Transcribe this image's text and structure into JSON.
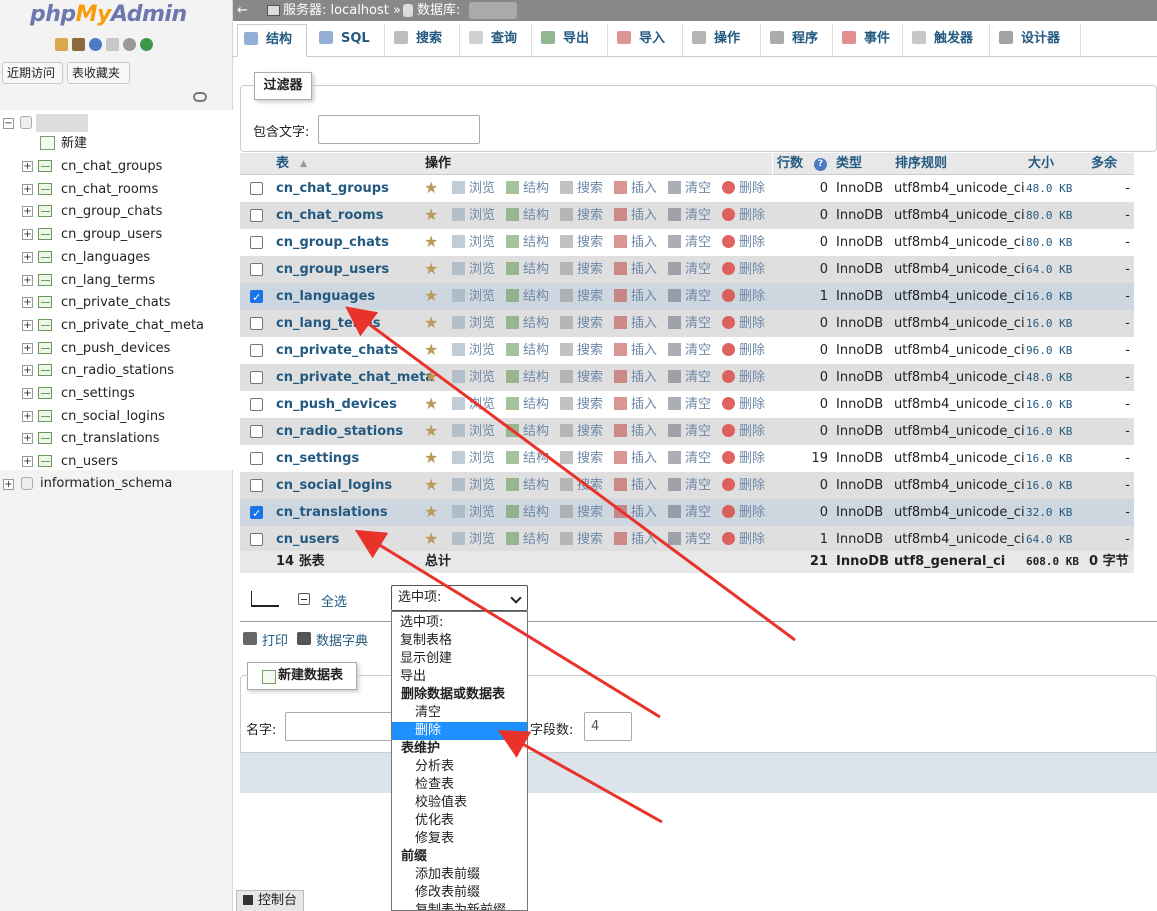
{
  "sidebar": {
    "logo": {
      "php": "php",
      "my": "My",
      "admin": "Admin"
    },
    "recent_button": "近期访问",
    "favorites_button": "表收藏夹",
    "new_label": "新建",
    "tables": [
      "cn_chat_groups",
      "cn_chat_rooms",
      "cn_group_chats",
      "cn_group_users",
      "cn_languages",
      "cn_lang_terms",
      "cn_private_chats",
      "cn_private_chat_meta",
      "cn_push_devices",
      "cn_radio_stations",
      "cn_settings",
      "cn_social_logins",
      "cn_translations",
      "cn_users"
    ],
    "other_db": "information_schema"
  },
  "breadcrumb": {
    "server": "服务器: localhost »",
    "database": "数据库: "
  },
  "tabs": [
    "结构",
    "SQL",
    "搜索",
    "查询",
    "导出",
    "导入",
    "操作",
    "程序",
    "事件",
    "触发器",
    "设计器"
  ],
  "filter": {
    "legend": "过滤器",
    "label": "包含文字:",
    "value": ""
  },
  "table_header": {
    "table": "表",
    "action": "操作",
    "rows": "行数",
    "type": "类型",
    "collation": "排序规则",
    "size": "大小",
    "overhead": "多余"
  },
  "actions": {
    "browse": "浏览",
    "structure": "结构",
    "search": "搜索",
    "insert": "插入",
    "empty": "清空",
    "drop": "删除"
  },
  "rows": [
    {
      "name": "cn_chat_groups",
      "rows": "0",
      "type": "InnoDB",
      "collation": "utf8mb4_unicode_ci",
      "size": "48.0 KB",
      "overhead": "-",
      "checked": false
    },
    {
      "name": "cn_chat_rooms",
      "rows": "0",
      "type": "InnoDB",
      "collation": "utf8mb4_unicode_ci",
      "size": "80.0 KB",
      "overhead": "-",
      "checked": false
    },
    {
      "name": "cn_group_chats",
      "rows": "0",
      "type": "InnoDB",
      "collation": "utf8mb4_unicode_ci",
      "size": "80.0 KB",
      "overhead": "-",
      "checked": false
    },
    {
      "name": "cn_group_users",
      "rows": "0",
      "type": "InnoDB",
      "collation": "utf8mb4_unicode_ci",
      "size": "64.0 KB",
      "overhead": "-",
      "checked": false
    },
    {
      "name": "cn_languages",
      "rows": "1",
      "type": "InnoDB",
      "collation": "utf8mb4_unicode_ci",
      "size": "16.0 KB",
      "overhead": "-",
      "checked": true
    },
    {
      "name": "cn_lang_terms",
      "rows": "0",
      "type": "InnoDB",
      "collation": "utf8mb4_unicode_ci",
      "size": "16.0 KB",
      "overhead": "-",
      "checked": false
    },
    {
      "name": "cn_private_chats",
      "rows": "0",
      "type": "InnoDB",
      "collation": "utf8mb4_unicode_ci",
      "size": "96.0 KB",
      "overhead": "-",
      "checked": false
    },
    {
      "name": "cn_private_chat_meta",
      "rows": "0",
      "type": "InnoDB",
      "collation": "utf8mb4_unicode_ci",
      "size": "48.0 KB",
      "overhead": "-",
      "checked": false
    },
    {
      "name": "cn_push_devices",
      "rows": "0",
      "type": "InnoDB",
      "collation": "utf8mb4_unicode_ci",
      "size": "16.0 KB",
      "overhead": "-",
      "checked": false
    },
    {
      "name": "cn_radio_stations",
      "rows": "0",
      "type": "InnoDB",
      "collation": "utf8mb4_unicode_ci",
      "size": "16.0 KB",
      "overhead": "-",
      "checked": false
    },
    {
      "name": "cn_settings",
      "rows": "19",
      "type": "InnoDB",
      "collation": "utf8mb4_unicode_ci",
      "size": "16.0 KB",
      "overhead": "-",
      "checked": false
    },
    {
      "name": "cn_social_logins",
      "rows": "0",
      "type": "InnoDB",
      "collation": "utf8mb4_unicode_ci",
      "size": "16.0 KB",
      "overhead": "-",
      "checked": false
    },
    {
      "name": "cn_translations",
      "rows": "0",
      "type": "InnoDB",
      "collation": "utf8mb4_unicode_ci",
      "size": "32.0 KB",
      "overhead": "-",
      "checked": true
    },
    {
      "name": "cn_users",
      "rows": "1",
      "type": "InnoDB",
      "collation": "utf8mb4_unicode_ci",
      "size": "64.0 KB",
      "overhead": "-",
      "checked": false
    }
  ],
  "footer": {
    "count": "14 张表",
    "total": "总计",
    "rows": "21",
    "type": "InnoDB",
    "collation": "utf8_general_ci",
    "size": "608.0 KB",
    "overhead": "0 字节"
  },
  "bulk": {
    "select_all": "全选",
    "selected": "选中项:"
  },
  "dropdown_options": [
    {
      "label": "选中项:",
      "kind": "opt"
    },
    {
      "label": "复制表格",
      "kind": "opt"
    },
    {
      "label": "显示创建",
      "kind": "opt"
    },
    {
      "label": "导出",
      "kind": "opt"
    },
    {
      "label": "删除数据或数据表",
      "kind": "grp"
    },
    {
      "label": "清空",
      "kind": "sub"
    },
    {
      "label": "删除",
      "kind": "sub",
      "highlight": true
    },
    {
      "label": "表维护",
      "kind": "grp"
    },
    {
      "label": "分析表",
      "kind": "sub"
    },
    {
      "label": "检查表",
      "kind": "sub"
    },
    {
      "label": "校验值表",
      "kind": "sub"
    },
    {
      "label": "优化表",
      "kind": "sub"
    },
    {
      "label": "修复表",
      "kind": "sub"
    },
    {
      "label": "前缀",
      "kind": "grp"
    },
    {
      "label": "添加表前缀",
      "kind": "sub"
    },
    {
      "label": "修改表前缀",
      "kind": "sub"
    },
    {
      "label": "复制表为新前缀",
      "kind": "sub"
    }
  ],
  "links": {
    "print": "打印",
    "dictionary": "数据字典"
  },
  "new_table": {
    "legend": "新建数据表",
    "name_label": "名字:",
    "name_value": "",
    "cols_label": "字段数:",
    "cols_value": "4"
  },
  "console": "控制台",
  "colors": {
    "link": "#235a81",
    "highlight": "#1e90ff",
    "arrow": "#e8322a",
    "selected_row": "#ced6df"
  }
}
